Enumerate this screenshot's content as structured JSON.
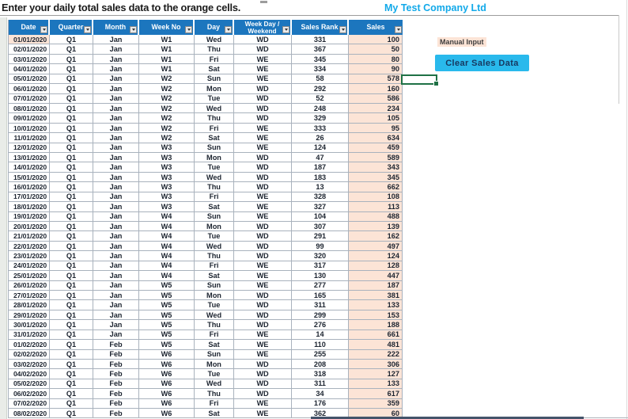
{
  "title": "Enter your daily total sales data to the orange cells.",
  "company": "My Test Company Ltd",
  "side": {
    "manual_input_label": "Manual Input",
    "clear_button_label": "Clear Sales Data"
  },
  "colors": {
    "header_blue": "#1C76BE",
    "orange_cell": "#FCE4D6",
    "grid_line": "#A9B2BD",
    "button_bg": "#29B9EC",
    "button_text": "#17375E",
    "company_text": "#12A9E9",
    "selection_green": "#1F7145"
  },
  "table": {
    "columns": [
      {
        "key": "date",
        "label": "Date",
        "width": 52,
        "align": "right"
      },
      {
        "key": "quarter",
        "label": "Quarter",
        "width": 55,
        "align": "center"
      },
      {
        "key": "month",
        "label": "Month",
        "width": 58,
        "align": "center"
      },
      {
        "key": "week_no",
        "label": "Week No",
        "width": 70,
        "align": "center"
      },
      {
        "key": "day",
        "label": "Day",
        "width": 50,
        "align": "center"
      },
      {
        "key": "week_day_weekend",
        "label": "Week Day / Weekend",
        "label_lines": [
          "Week Day /",
          "Weekend"
        ],
        "width": 73,
        "align": "center"
      },
      {
        "key": "sales_rank",
        "label": "Sales Rank",
        "width": 72,
        "align": "center"
      },
      {
        "key": "sales",
        "label": "Sales",
        "width": 68,
        "align": "right"
      }
    ],
    "rows": [
      [
        "01/01/2020",
        "Q1",
        "Jan",
        "W1",
        "Wed",
        "WD",
        331,
        100
      ],
      [
        "02/01/2020",
        "Q1",
        "Jan",
        "W1",
        "Thu",
        "WD",
        367,
        50
      ],
      [
        "03/01/2020",
        "Q1",
        "Jan",
        "W1",
        "Fri",
        "WE",
        345,
        80
      ],
      [
        "04/01/2020",
        "Q1",
        "Jan",
        "W1",
        "Sat",
        "WE",
        334,
        90
      ],
      [
        "05/01/2020",
        "Q1",
        "Jan",
        "W2",
        "Sun",
        "WE",
        58,
        578
      ],
      [
        "06/01/2020",
        "Q1",
        "Jan",
        "W2",
        "Mon",
        "WD",
        292,
        160
      ],
      [
        "07/01/2020",
        "Q1",
        "Jan",
        "W2",
        "Tue",
        "WD",
        52,
        586
      ],
      [
        "08/01/2020",
        "Q1",
        "Jan",
        "W2",
        "Wed",
        "WD",
        248,
        234
      ],
      [
        "09/01/2020",
        "Q1",
        "Jan",
        "W2",
        "Thu",
        "WD",
        329,
        105
      ],
      [
        "10/01/2020",
        "Q1",
        "Jan",
        "W2",
        "Fri",
        "WE",
        333,
        95
      ],
      [
        "11/01/2020",
        "Q1",
        "Jan",
        "W2",
        "Sat",
        "WE",
        26,
        634
      ],
      [
        "12/01/2020",
        "Q1",
        "Jan",
        "W3",
        "Sun",
        "WE",
        124,
        459
      ],
      [
        "13/01/2020",
        "Q1",
        "Jan",
        "W3",
        "Mon",
        "WD",
        47,
        589
      ],
      [
        "14/01/2020",
        "Q1",
        "Jan",
        "W3",
        "Tue",
        "WD",
        187,
        343
      ],
      [
        "15/01/2020",
        "Q1",
        "Jan",
        "W3",
        "Wed",
        "WD",
        183,
        345
      ],
      [
        "16/01/2020",
        "Q1",
        "Jan",
        "W3",
        "Thu",
        "WD",
        13,
        662
      ],
      [
        "17/01/2020",
        "Q1",
        "Jan",
        "W3",
        "Fri",
        "WE",
        328,
        108
      ],
      [
        "18/01/2020",
        "Q1",
        "Jan",
        "W3",
        "Sat",
        "WE",
        327,
        113
      ],
      [
        "19/01/2020",
        "Q1",
        "Jan",
        "W4",
        "Sun",
        "WE",
        104,
        488
      ],
      [
        "20/01/2020",
        "Q1",
        "Jan",
        "W4",
        "Mon",
        "WD",
        307,
        139
      ],
      [
        "21/01/2020",
        "Q1",
        "Jan",
        "W4",
        "Tue",
        "WD",
        291,
        162
      ],
      [
        "22/01/2020",
        "Q1",
        "Jan",
        "W4",
        "Wed",
        "WD",
        99,
        497
      ],
      [
        "23/01/2020",
        "Q1",
        "Jan",
        "W4",
        "Thu",
        "WD",
        320,
        124
      ],
      [
        "24/01/2020",
        "Q1",
        "Jan",
        "W4",
        "Fri",
        "WE",
        317,
        128
      ],
      [
        "25/01/2020",
        "Q1",
        "Jan",
        "W4",
        "Sat",
        "WE",
        130,
        447
      ],
      [
        "26/01/2020",
        "Q1",
        "Jan",
        "W5",
        "Sun",
        "WE",
        277,
        187
      ],
      [
        "27/01/2020",
        "Q1",
        "Jan",
        "W5",
        "Mon",
        "WD",
        165,
        381
      ],
      [
        "28/01/2020",
        "Q1",
        "Jan",
        "W5",
        "Tue",
        "WD",
        311,
        133
      ],
      [
        "29/01/2020",
        "Q1",
        "Jan",
        "W5",
        "Wed",
        "WD",
        299,
        153
      ],
      [
        "30/01/2020",
        "Q1",
        "Jan",
        "W5",
        "Thu",
        "WD",
        276,
        188
      ],
      [
        "31/01/2020",
        "Q1",
        "Jan",
        "W5",
        "Fri",
        "WE",
        14,
        661
      ],
      [
        "01/02/2020",
        "Q1",
        "Feb",
        "W5",
        "Sat",
        "WE",
        110,
        481
      ],
      [
        "02/02/2020",
        "Q1",
        "Feb",
        "W6",
        "Sun",
        "WE",
        255,
        222
      ],
      [
        "03/02/2020",
        "Q1",
        "Feb",
        "W6",
        "Mon",
        "WD",
        208,
        306
      ],
      [
        "04/02/2020",
        "Q1",
        "Feb",
        "W6",
        "Tue",
        "WD",
        318,
        127
      ],
      [
        "05/02/2020",
        "Q1",
        "Feb",
        "W6",
        "Wed",
        "WD",
        311,
        133
      ],
      [
        "06/02/2020",
        "Q1",
        "Feb",
        "W6",
        "Thu",
        "WD",
        34,
        617
      ],
      [
        "07/02/2020",
        "Q1",
        "Feb",
        "W6",
        "Fri",
        "WE",
        176,
        359
      ],
      [
        "08/02/2020",
        "Q1",
        "Feb",
        "W6",
        "Sat",
        "WE",
        362,
        60
      ]
    ]
  }
}
